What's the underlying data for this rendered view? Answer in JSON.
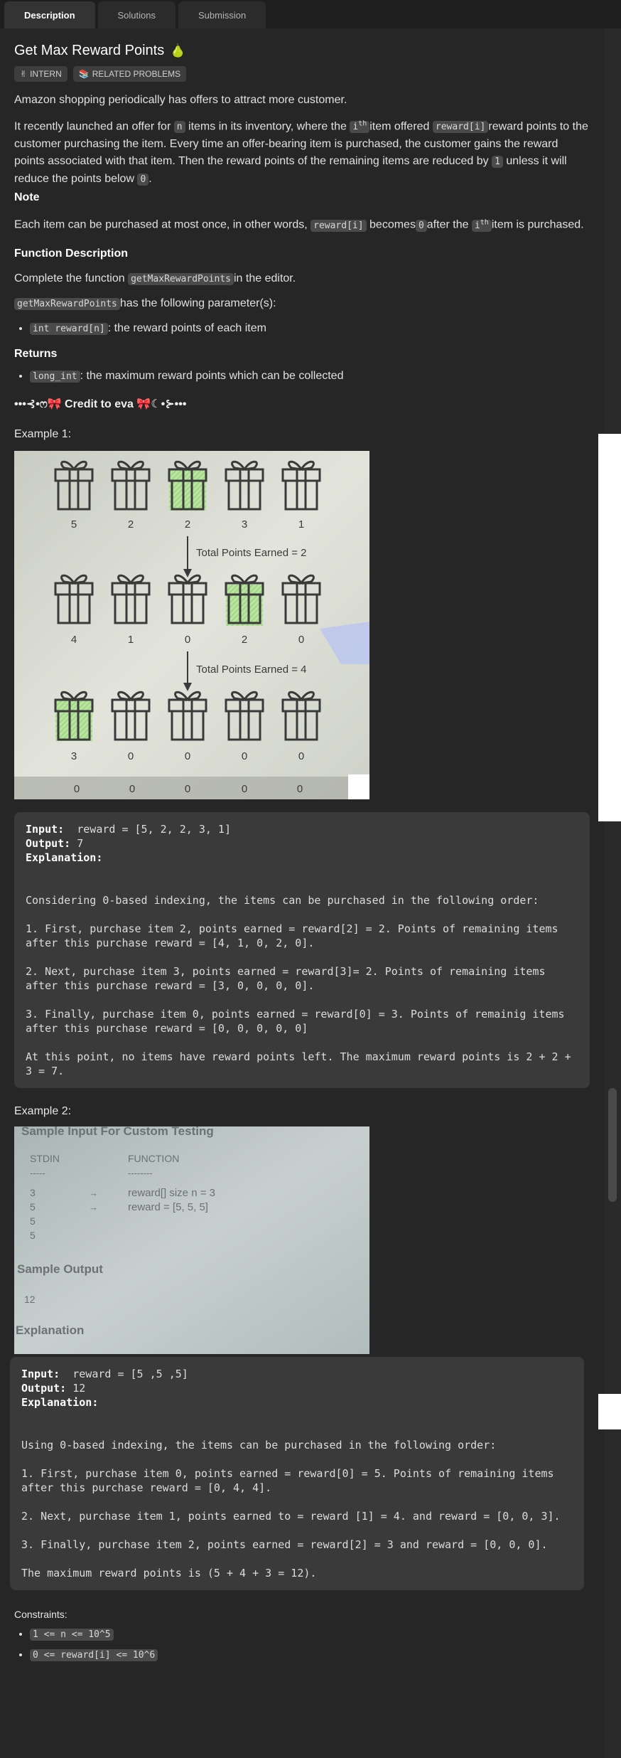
{
  "tabs": [
    {
      "label": "Description"
    },
    {
      "label": "Solutions"
    },
    {
      "label": "Submission"
    }
  ],
  "problem": {
    "title": "Get Max Reward Points",
    "tags": [
      {
        "icon": "✌",
        "label": "INTERN"
      },
      {
        "icon": "📚",
        "label": "RELATED PROBLEMS"
      }
    ],
    "intro": "Amazon shopping periodically has offers to attract more customer.",
    "p1_a": "It recently launched an offer for",
    "p1_n": "n",
    "p1_b": "items in its inventory, where the",
    "p1_ith": "i",
    "p1_sup": "th",
    "p1_c": "item offered",
    "p1_reward": "reward[i]",
    "p1_d": "reward points to the customer purchasing the item. Every time an offer-bearing item is purchased, the customer gains the reward points associated with that item. Then the reward points of the remaining items are reduced by",
    "p1_one": "1",
    "p1_e": "unless it will reduce the points below",
    "p1_zero": "0",
    "p1_f": ".",
    "note_heading": "Note",
    "note_a": "Each item can be purchased at most once, in other words,",
    "note_reward": "reward[i]",
    "note_b": "becomes",
    "note_zero": "0",
    "note_c": "after the",
    "note_ith": "i",
    "note_sup": "th",
    "note_d": "item is purchased.",
    "fd_heading": "Function Description",
    "fd_a": "Complete the function",
    "fd_fn": "getMaxRewardPoints",
    "fd_b": "in the editor.",
    "fd_fn2": "getMaxRewardPoints",
    "fd_c": "has the following parameter(s):",
    "param_code": "int reward[n]",
    "param_desc": ": the reward points of each item",
    "returns_heading": "Returns",
    "returns_code": "long_int",
    "returns_desc": ": the maximum reward points which can be collected",
    "credit": "•••⊰•ෆ🎀 Credit to eva 🎀☾•⊱•••"
  },
  "example1": {
    "title": "Example 1:",
    "figure": {
      "row1": [
        "5",
        "2",
        "2",
        "3",
        "1"
      ],
      "earned1": "Total Points Earned = 2",
      "row2": [
        "4",
        "1",
        "0",
        "2",
        "0"
      ],
      "earned2": "Total Points Earned = 4",
      "row3": [
        "3",
        "0",
        "0",
        "0",
        "0"
      ],
      "row4": [
        "0",
        "0",
        "0",
        "0",
        "0"
      ]
    },
    "input_label": "Input:",
    "input_value": "reward = [5, 2, 2, 3, 1]",
    "output_label": "Output:",
    "output_value": "7",
    "explanation_label": "Explanation:",
    "explanation": "Considering 0-based indexing, the items can be purchased in the following order:\n\n1. First, purchase item 2, points earned = reward[2] = 2. Points of remaining items after this purchase reward = [4, 1, 0, 2, 0].\n\n2. Next, purchase item 3, points earned = reward[3]= 2. Points of remaining items after this purchase reward = [3, 0, 0, 0, 0].\n\n3. Finally, purchase item 0, points earned = reward[0] = 3. Points of remainig items after this purchase reward = [0, 0, 0, 0, 0]\n\nAt this point, no items have reward points left. The maximum reward points is 2 + 2 + 3 = 7."
  },
  "example2": {
    "title": "Example 2:",
    "figure": {
      "header": "Sample Input For Custom Testing",
      "col1": "STDIN",
      "col2": "FUNCTION",
      "dash1": "-----",
      "dash2": "--------",
      "stdin": [
        "3",
        "5",
        "5",
        "5"
      ],
      "arrow": "→",
      "func1": "reward[] size n = 3",
      "func2": "reward = [5, 5, 5]",
      "sample_output": "Sample Output",
      "output_value": "12",
      "explanation": "Explanation"
    },
    "input_label": "Input:",
    "input_value": "reward = [5 ,5 ,5]",
    "output_label": "Output:",
    "output_value": "12",
    "explanation_label": "Explanation:",
    "explanation": "Using 0-based indexing, the items can be purchased in the following order:\n\n1. First, purchase item 0, points earned = reward[0] = 5. Points of remaining items after this purchase reward = [0, 4, 4].\n\n2. Next, purchase item 1, points earned to = reward [1] = 4. and reward = [0, 0, 3].\n\n3. Finally, purchase item 2, points earned = reward[2] = 3 and reward = [0, 0, 0].\n\nThe maximum reward points is (5 + 4 + 3 = 12)."
  },
  "constraints": {
    "title": "Constraints:",
    "items": [
      "1 <= n <= 10^5",
      "0 <= reward[i] <= 10^6"
    ]
  },
  "colors": {
    "background": "#262626",
    "code_bg": "#3a3a3a",
    "inline_code_bg": "#4a4a4a",
    "highlight_green": "#9ed97e"
  }
}
